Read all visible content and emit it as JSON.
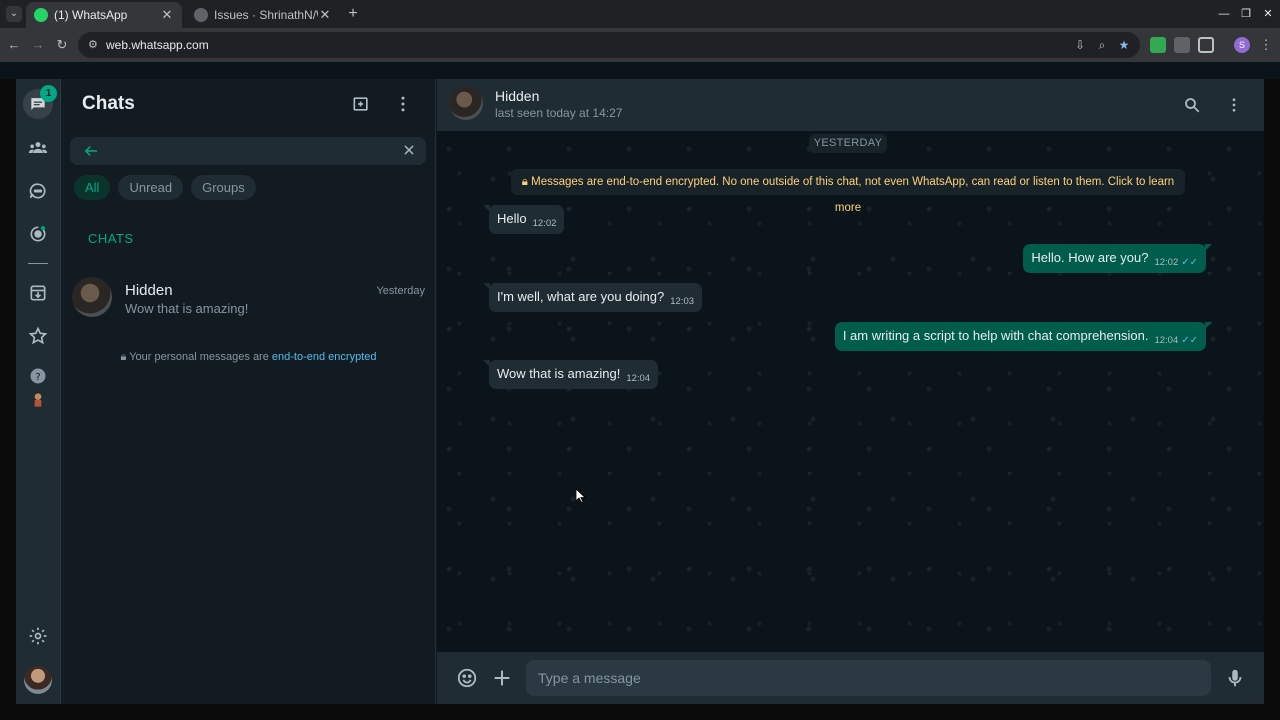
{
  "browser": {
    "tabs": [
      {
        "title": "(1) WhatsApp",
        "favicon_color": "#25d366",
        "active": true
      },
      {
        "title": "Issues · ShrinathN/W",
        "favicon_color": "#5f6368",
        "active": false
      }
    ],
    "url": "web.whatsapp.com",
    "profile_initial": "S"
  },
  "rail": {
    "chats_badge": "1",
    "icons": [
      "chats-icon",
      "communities-icon",
      "channels-icon",
      "status-icon",
      "archived-icon",
      "starred-icon",
      "help-icon",
      "settings-icon"
    ]
  },
  "sidebar": {
    "title": "Chats",
    "search_placeholder": "",
    "filters": [
      "All",
      "Unread",
      "Groups"
    ],
    "section_label": "CHATS",
    "chats": [
      {
        "name": "Hidden",
        "time": "Yesterday",
        "last_message": "Wow that is amazing!"
      }
    ],
    "encryption_note": "Your personal messages are",
    "encryption_link": "end-to-end encrypted"
  },
  "conversation": {
    "contact_name": "Hidden",
    "status": "last seen today at 14:27",
    "date_label": "YESTERDAY",
    "system_note": "Messages are end-to-end encrypted. No one outside of this chat, not even WhatsApp, can read or listen to them. Click to learn more",
    "messages": [
      {
        "direction": "in",
        "text": "Hello",
        "time": "12:02"
      },
      {
        "direction": "out",
        "text": "Hello. How are you?",
        "time": "12:02",
        "read": true
      },
      {
        "direction": "in",
        "text": "I'm well, what are you doing?",
        "time": "12:03"
      },
      {
        "direction": "out",
        "text": "I am writing a script to help with chat comprehension.",
        "time": "12:04",
        "read": true
      },
      {
        "direction": "in",
        "text": "Wow that is amazing!",
        "time": "12:04"
      }
    ],
    "composer_placeholder": "Type a message"
  },
  "colors": {
    "accent": "#00a884",
    "outgoing_bubble": "#005c4b",
    "incoming_bubble": "#202c33",
    "read_ticks": "#53bdeb",
    "system_note_text": "#ffd279"
  }
}
